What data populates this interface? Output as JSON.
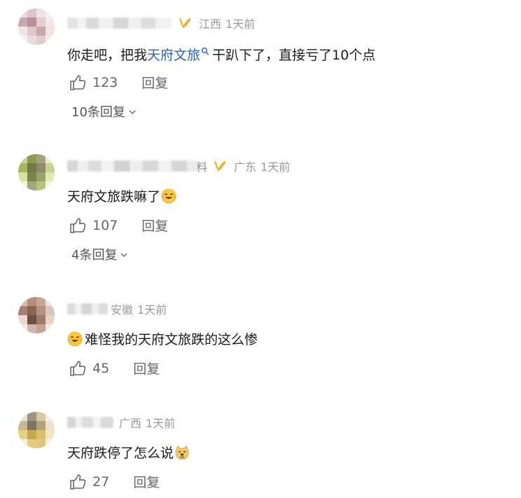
{
  "comments": [
    {
      "name_tail": "",
      "location": "江西",
      "time": "1天前",
      "text_before": "你走吧，把我",
      "topic": "天府文旅",
      "text_after": "干趴下了，直接亏了10个点",
      "likes": "123",
      "reply_label": "回复",
      "replies_label": "10条回复",
      "vip": true
    },
    {
      "name_tail": "料",
      "location": "广东",
      "time": "1天前",
      "text": "天府文旅跌嘛了",
      "emoji": "laugh-cry-emoji",
      "likes": "107",
      "reply_label": "回复",
      "replies_label": "4条回复",
      "vip": true
    },
    {
      "name_tail": "",
      "location": "安徽",
      "time": "1天前",
      "emoji": "laugh-cry-emoji",
      "text": "难怪我的天府文旅跌的这么惨",
      "likes": "45",
      "reply_label": "回复"
    },
    {
      "name_tail": "",
      "location": "广西",
      "time": "1天前",
      "text": "天府跌停了怎么说",
      "emoji": "doge-emoji",
      "likes": "27",
      "reply_label": "回复"
    }
  ],
  "colors": {
    "topic_link": "#2a62c3",
    "vip_badge": "#f5a623",
    "meta_gray": "#999999",
    "action_gray": "#666666"
  }
}
